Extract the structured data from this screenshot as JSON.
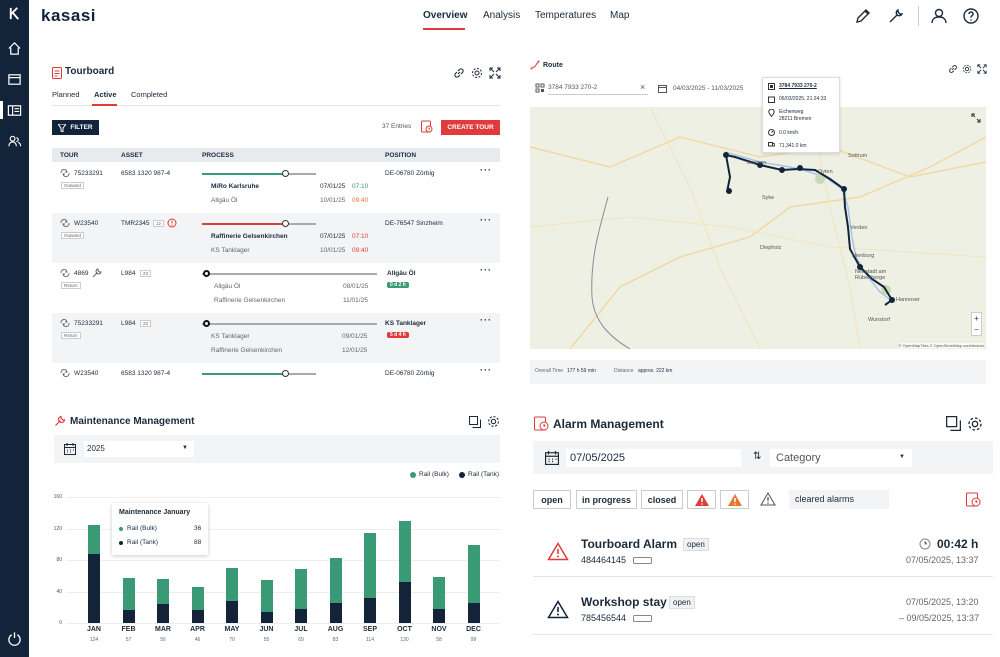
{
  "app": {
    "logo": "kasasi"
  },
  "sidebar": {
    "icons": [
      "logo-k-icon",
      "home-icon",
      "tours-icon",
      "dashboard-icon",
      "users-icon",
      "power-icon"
    ]
  },
  "nav": {
    "items": [
      "Overview",
      "Analysis",
      "Temperatures",
      "Map"
    ],
    "active": "Overview"
  },
  "tourboard": {
    "title": "Tourboard",
    "tabs": [
      "Planned",
      "Active",
      "Completed"
    ],
    "active_tab": "Active",
    "filter_label": "FILTER",
    "entries": "37 Entries",
    "create_label": "CREATE TOUR",
    "headers": {
      "tour": "TOUR",
      "asset": "ASSET",
      "process": "PROCESS",
      "position": "POSITION"
    },
    "rows": [
      {
        "tour": "75233291",
        "type": "Outward",
        "asset": "6583 1320 987-4",
        "asset_count": "",
        "stop1": "MiRo Karlsruhe",
        "date1": "07/01/25",
        "time1": "07:10",
        "stop2": "Allgäu Öl",
        "date2": "10/01/25",
        "time2": "09:40",
        "position": "DE-06780 Zörbig",
        "pill": "",
        "progress": 0.75
      },
      {
        "tour": "W23540",
        "type": "Outward",
        "asset": "TMR2345",
        "asset_count": "12",
        "stop1": "Raffinerie Gelsenkirchen",
        "date1": "07/01/25",
        "time1": "07:10",
        "stop2": "KS Tanklager",
        "date2": "10/01/25",
        "time2": "09:40",
        "position": "DE-76547 Sinzheim",
        "pill": "",
        "progress": 0.75
      },
      {
        "tour": "4869",
        "type": "Return",
        "asset": "L984",
        "asset_count": "23",
        "stop1": "Allgäu Öl",
        "date1": "08/01/25",
        "time1": "",
        "stop2": "Raffinerie Gelsenkirchen",
        "date2": "11/01/25",
        "time2": "",
        "position": "Allgäu Öl",
        "pill": "0 d 2 h",
        "progress": 0
      },
      {
        "tour": "75233291",
        "type": "Return",
        "asset": "L984",
        "asset_count": "23",
        "stop1": "KS Tanklager",
        "date1": "09/01/25",
        "time1": "",
        "stop2": "Raffinerie Gelsenkirchen",
        "date2": "12/01/25",
        "time2": "",
        "position": "KS Tanklager",
        "pill": "5 d 4 h",
        "progress": 0
      },
      {
        "tour": "W23540",
        "type": "",
        "asset": "6583 1320 987-4",
        "asset_count": "",
        "stop1": "",
        "date1": "",
        "time1": "",
        "stop2": "",
        "date2": "",
        "time2": "",
        "position": "DE-06780 Zörbig",
        "pill": "",
        "progress": 0.75
      }
    ]
  },
  "route": {
    "title": "Route",
    "search_value": "3784 7933 270-2",
    "date_range": "04/03/2025 - 11/03/2025",
    "popup": {
      "id": "3784 7933 270-2",
      "datetime": "06/03/2025, 21:24:33",
      "street": "Eichenweg",
      "city": "28211 Bremen",
      "speed": "0.0 km/h",
      "odometer": "71,341.0 km"
    },
    "overall_time_label": "Overall Time",
    "overall_time": "177 h 59 min",
    "distance_label": "Distance",
    "distance": "approx. 222 km",
    "attribution": "© OpenMapTiles © OpenStreetMap contributors",
    "places": [
      "Oyten",
      "Bremen",
      "Sottrum",
      "Syke",
      "Diepholz",
      "Nienburg",
      "Neustadt am Rübenberge",
      "Hannover",
      "Wunstorf",
      "Verden"
    ]
  },
  "maintenance": {
    "title": "Maintenance Management",
    "year": "2025",
    "legend": [
      "Rail (Bulk)",
      "Rail (Tank)"
    ],
    "tooltip": {
      "title": "Maintenance January",
      "rows": [
        {
          "name": "Rail (Bulk)",
          "value": "36"
        },
        {
          "name": "Rail (Tank)",
          "value": "88"
        }
      ]
    }
  },
  "chart_data": {
    "type": "bar",
    "stacked": true,
    "categories": [
      "JAN",
      "FEB",
      "MAR",
      "APR",
      "MAY",
      "JUN",
      "JUL",
      "AUG",
      "SEP",
      "OCT",
      "NOV",
      "DEC"
    ],
    "totals": [
      "124",
      "57",
      "56",
      "46",
      "70",
      "55",
      "69",
      "83",
      "114",
      "130",
      "58",
      "99"
    ],
    "series": [
      {
        "name": "Rail (Tank)",
        "color": "#13243a",
        "values": [
          88,
          16,
          24,
          16,
          28,
          14,
          18,
          26,
          32,
          52,
          18,
          26
        ]
      },
      {
        "name": "Rail (Bulk)",
        "color": "#3a9a76",
        "values": [
          36,
          41,
          32,
          30,
          42,
          41,
          51,
          57,
          82,
          78,
          40,
          73
        ]
      }
    ],
    "yticks": [
      0,
      40,
      80,
      120,
      160
    ],
    "ylim": [
      0,
      160
    ],
    "grid": true,
    "legend": "top-right"
  },
  "alarm": {
    "title": "Alarm Management",
    "date_value": "07/05/2025",
    "category_placeholder": "Category",
    "filters": {
      "open": "open",
      "in_progress": "in progress",
      "closed": "closed",
      "cleared": "cleared alarms"
    },
    "items": [
      {
        "title": "Tourboard Alarm",
        "status": "open",
        "id": "484464145",
        "duration": "00:42 h",
        "time": "07/05/2025, 13:37"
      },
      {
        "title": "Workshop stay",
        "status": "open",
        "id": "785456544",
        "time_start": "07/05/2025, 13:20",
        "time_end": "– 09/05/2025, 13:37"
      }
    ]
  },
  "colors": {
    "navy": "#13243a",
    "red": "#e03b3b",
    "green": "#3a9a76",
    "orange": "#e8772e"
  }
}
